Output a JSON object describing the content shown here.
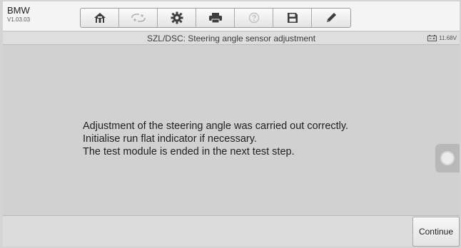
{
  "app": {
    "name": "BMW",
    "version": "V1.03.03"
  },
  "toolbar": {
    "items": [
      {
        "icon": "home-icon",
        "enabled": true
      },
      {
        "icon": "vehicle-swap-icon",
        "enabled": false
      },
      {
        "icon": "gear-icon",
        "enabled": true
      },
      {
        "icon": "printer-icon",
        "enabled": true
      },
      {
        "icon": "help-icon",
        "enabled": false
      },
      {
        "icon": "save-icon",
        "enabled": true
      },
      {
        "icon": "pen-icon",
        "enabled": true
      }
    ]
  },
  "header": {
    "title": "SZL/DSC: Steering angle sensor adjustment",
    "battery_voltage": "11.68V"
  },
  "message": {
    "lines": [
      "Adjustment of the steering angle was carried out correctly.",
      "Initialise run flat indicator if necessary.",
      "The test module is ended in the next test step."
    ]
  },
  "footer": {
    "continue_label": "Continue"
  }
}
